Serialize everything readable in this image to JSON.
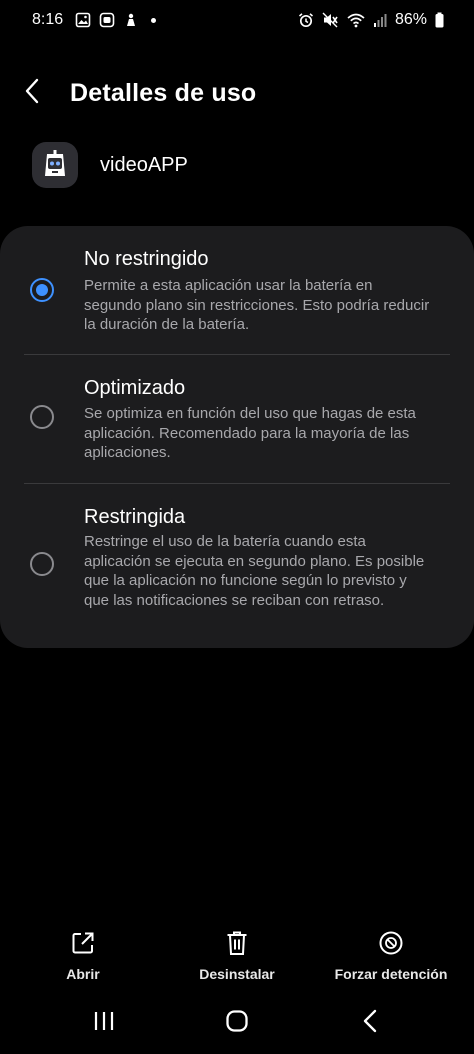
{
  "status_bar": {
    "time": "8:16",
    "battery_percent": "86%",
    "left_icons": [
      "gallery-icon",
      "assistant-icon",
      "notification-icon"
    ],
    "right_icons": [
      "alarm-icon",
      "mute-icon",
      "wifi-icon",
      "signal-icon",
      "battery-icon"
    ]
  },
  "header": {
    "title": "Detalles de uso",
    "back_icon": "chevron-left-icon"
  },
  "app": {
    "name": "videoAPP",
    "icon": "app-robot-icon"
  },
  "options": [
    {
      "title": "No restringido",
      "description": "Permite a esta aplicación usar la batería en segundo plano sin restricciones. Esto podría reducir la duración de la batería.",
      "selected": true
    },
    {
      "title": "Optimizado",
      "description": "Se optimiza en función del uso que hagas de esta aplicación. Recomendado para la mayoría de las aplicaciones.",
      "selected": false
    },
    {
      "title": "Restringida",
      "description": "Restringe el uso de la batería cuando esta aplicación se ejecuta en segundo plano. Es posible que la aplicación no funcione según lo previsto y que las notificaciones se reciban con retraso.",
      "selected": false
    }
  ],
  "actions": [
    {
      "label": "Abrir",
      "icon": "open-external-icon"
    },
    {
      "label": "Desinstalar",
      "icon": "trash-icon"
    },
    {
      "label": "Forzar detención",
      "icon": "stop-icon"
    }
  ],
  "nav": {
    "recents_icon": "recents-icon",
    "home_icon": "home-icon",
    "back_icon": "back-icon"
  },
  "colors": {
    "accent": "#3e91ff",
    "card": "#1c1c1e",
    "background": "#000000",
    "secondary_text": "#a8a8ac"
  }
}
